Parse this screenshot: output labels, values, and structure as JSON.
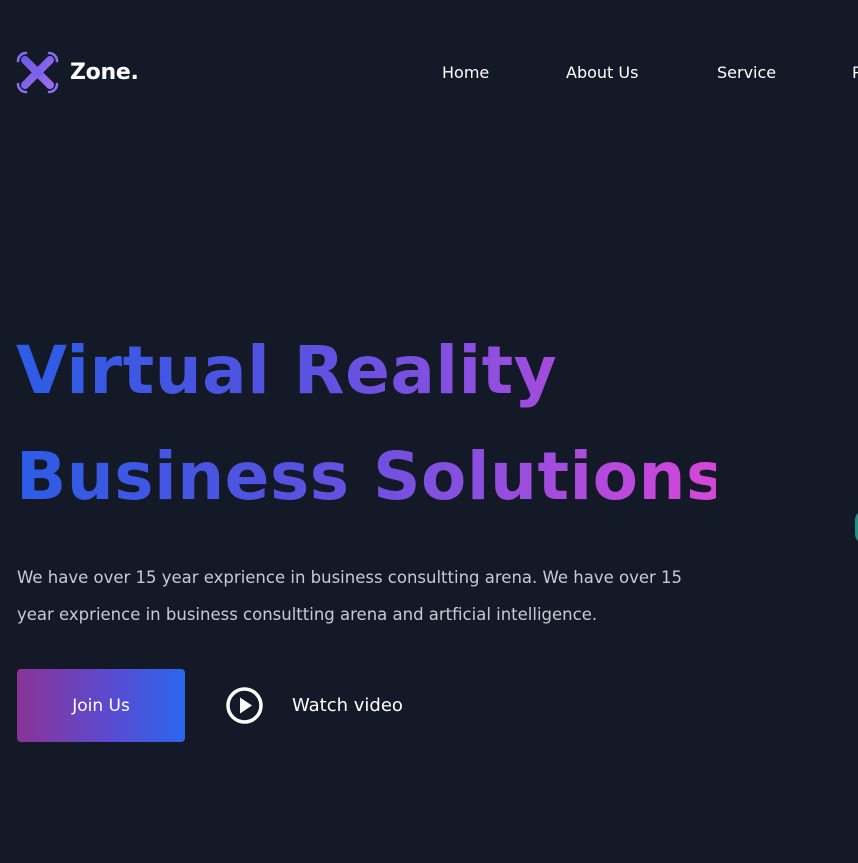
{
  "brand": {
    "name": "Zone.",
    "accent_colors": [
      "#2c5ce6",
      "#8a4fe0",
      "#d646d8"
    ],
    "background": "#131927"
  },
  "nav": {
    "items": [
      {
        "label": "Home"
      },
      {
        "label": "About Us"
      },
      {
        "label": "Service"
      },
      {
        "label": "P"
      }
    ]
  },
  "hero": {
    "title_line1": "Virtual Reality",
    "title_line2": "Business Solutions",
    "description": "We have over 15 year exprience in business consultting arena. We have over 15 year exprience in business consultting arena and artficial intelligence.",
    "primary_button": "Join Us",
    "secondary_button": "Watch video",
    "secondary_icon": "play-circle-icon"
  }
}
